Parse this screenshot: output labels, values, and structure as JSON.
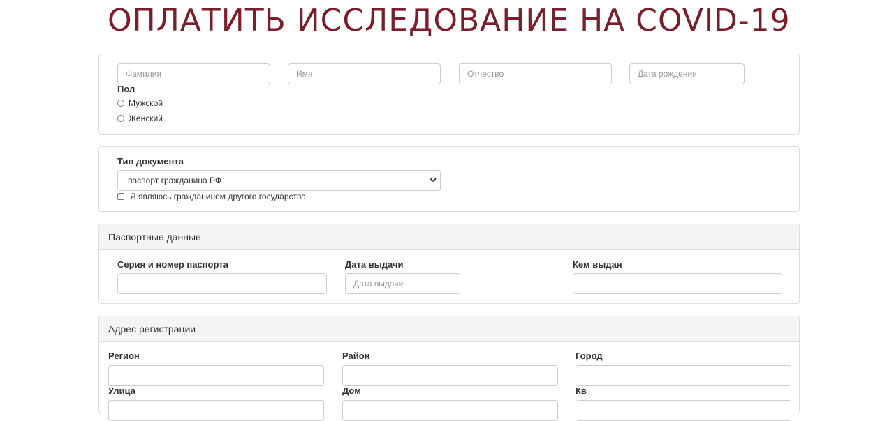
{
  "title": "ОПЛАТИТЬ ИССЛЕДОВАНИЕ НА COVID-19",
  "personal": {
    "last_name_placeholder": "Фамилия",
    "first_name_placeholder": "Имя",
    "patronymic_placeholder": "Отчество",
    "birthdate_placeholder": "Дата рождения",
    "gender_label": "Пол",
    "gender_options": [
      "Мужской",
      "Женский"
    ]
  },
  "document": {
    "type_label": "Тип документа",
    "type_value": "паспорт гражданина РФ",
    "foreign_citizen_label": "Я являюсь гражданином другого государства"
  },
  "passport": {
    "heading": "Паспортные данные",
    "series_label": "Серия и номер паспорта",
    "issue_date_label": "Дата выдачи",
    "issue_date_placeholder": "Дата выдачи",
    "issued_by_label": "Кем выдан"
  },
  "address": {
    "heading": "Адрес регистрации",
    "region_label": "Регион",
    "district_label": "Район",
    "city_label": "Город",
    "street_label": "Улица",
    "house_label": "Дом",
    "apartment_label": "Кв"
  },
  "colors": {
    "title": "#7b1e2b",
    "panel_border": "#dddddd",
    "panel_heading_bg": "#f5f5f5"
  }
}
